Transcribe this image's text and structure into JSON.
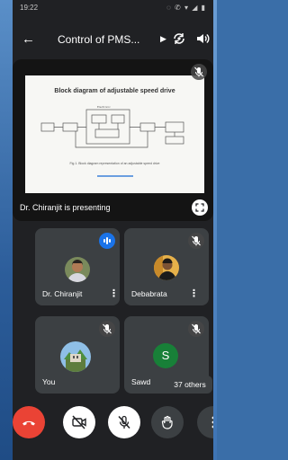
{
  "status_bar": {
    "time": "19:22",
    "icons": "◌ ✆ ▾ ◢ ▮"
  },
  "app_bar": {
    "title": "Control of PMS..."
  },
  "presentation": {
    "presenter_label": "Dr. Chiranjit is presenting",
    "slide_title": "Block diagram of adjustable speed drive",
    "slide_caption": "Fig.1. Block diagram representation of an adjustable speed drive"
  },
  "participants": [
    {
      "name": "Dr. Chiranjit",
      "speaking": true,
      "muted": false
    },
    {
      "name": "Debabrata",
      "speaking": false,
      "muted": true
    },
    {
      "name": "You",
      "speaking": false,
      "muted": true
    },
    {
      "name": "Sawd",
      "initial": "S",
      "speaking": false,
      "muted": true
    }
  ],
  "others_chip": "37 others",
  "colors": {
    "background": "#202124",
    "tile": "#3c4043",
    "end_call": "#ea4335",
    "accent_blue": "#1a73e8",
    "avatar_green": "#188038"
  }
}
